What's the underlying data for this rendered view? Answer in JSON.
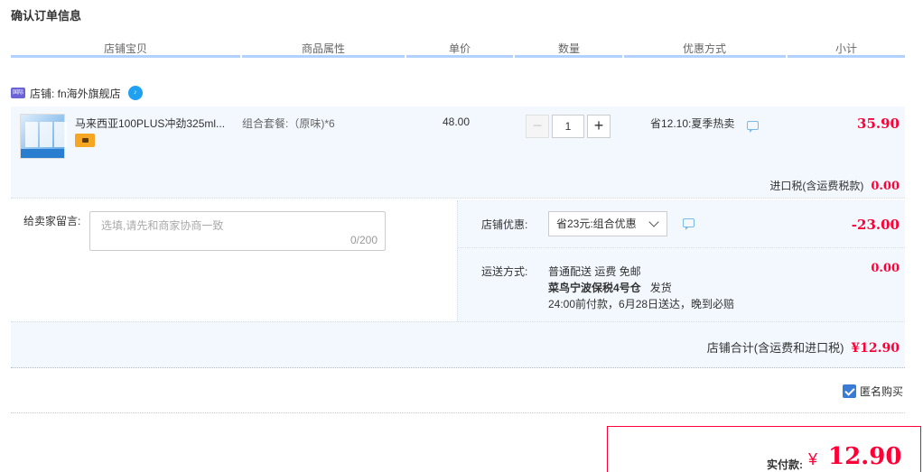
{
  "page": {
    "title": "确认订单信息"
  },
  "columns": [
    "店铺宝贝",
    "商品属性",
    "单价",
    "数量",
    "优惠方式",
    "小计"
  ],
  "shop": {
    "badge": "国际",
    "name": "店铺: fn海外旗舰店"
  },
  "item": {
    "name": "马来西亚100PLUS冲劲325ml...",
    "attr": "组合套餐:（原味)*6",
    "price": "48.00",
    "qty": "1",
    "minus": "−",
    "plus": "+",
    "promo": "省12.10:夏季热卖",
    "subtotal": "35.90"
  },
  "tax": {
    "label": "进口税(含运费税款)",
    "value": "0.00"
  },
  "message": {
    "label": "给卖家留言:",
    "placeholder": "选填,请先和商家协商一致",
    "count": "0/200"
  },
  "discount": {
    "label": "店铺优惠:",
    "selected": "省23元:组合优惠",
    "value": "-23.00"
  },
  "shipping": {
    "label": "运送方式:",
    "line1": "普通配送 运费 免邮",
    "line2_bold": "菜鸟宁波保税4号仓",
    "line2_rest": "发货",
    "line3": "24:00前付款，6月28日送达，晚到必赔",
    "value": "0.00"
  },
  "shop_total": {
    "label": "店铺合计(含运费和进口税)",
    "value": "¥12.90"
  },
  "anonymous": {
    "label": "匿名购买",
    "checked": true
  },
  "pay": {
    "label": "实付款:",
    "currency": "¥",
    "value": "12.90"
  },
  "colors": {
    "accent": "#ff0036",
    "panel": "#f3f8fe",
    "header_line": "#b2d1ff",
    "checkbox": "#3a7bd5"
  }
}
